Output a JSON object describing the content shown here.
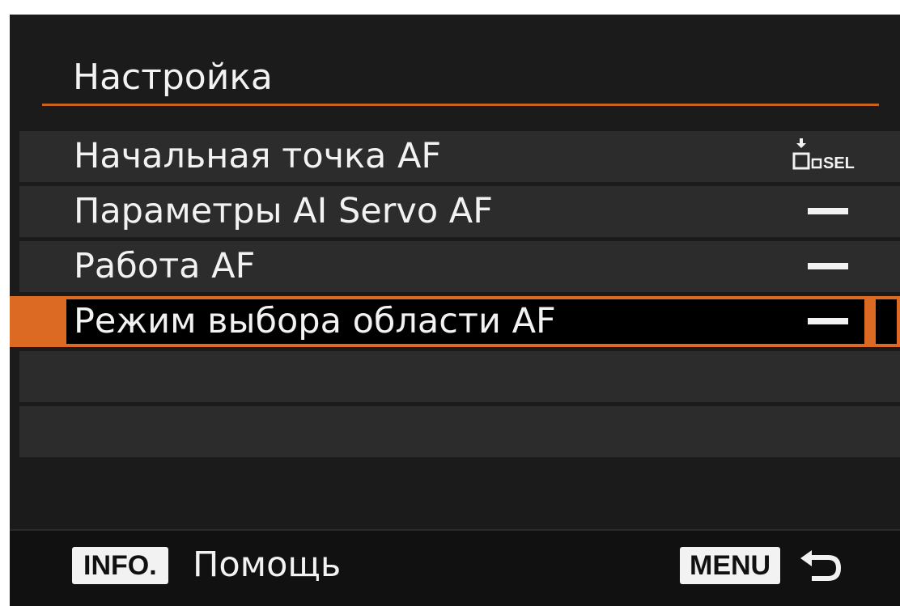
{
  "screen": {
    "title": "Настройка",
    "accent_color": "#dd6a22"
  },
  "menu": {
    "items": [
      {
        "label": "Начальная точка AF",
        "value_icon": "af-start-point-sel-icon",
        "selected": false
      },
      {
        "label": "Параметры AI Servo AF",
        "value_icon": "dash-icon",
        "selected": false
      },
      {
        "label": "Работа AF",
        "value_icon": "dash-icon",
        "selected": false
      },
      {
        "label": "Режим выбора области AF",
        "value_icon": "dash-icon",
        "selected": true
      }
    ],
    "af_icon_text": "SEL"
  },
  "footer": {
    "info_label": "INFO.",
    "help_label": "Помощь",
    "menu_label": "MENU",
    "return_icon": "return-arrow-icon"
  }
}
